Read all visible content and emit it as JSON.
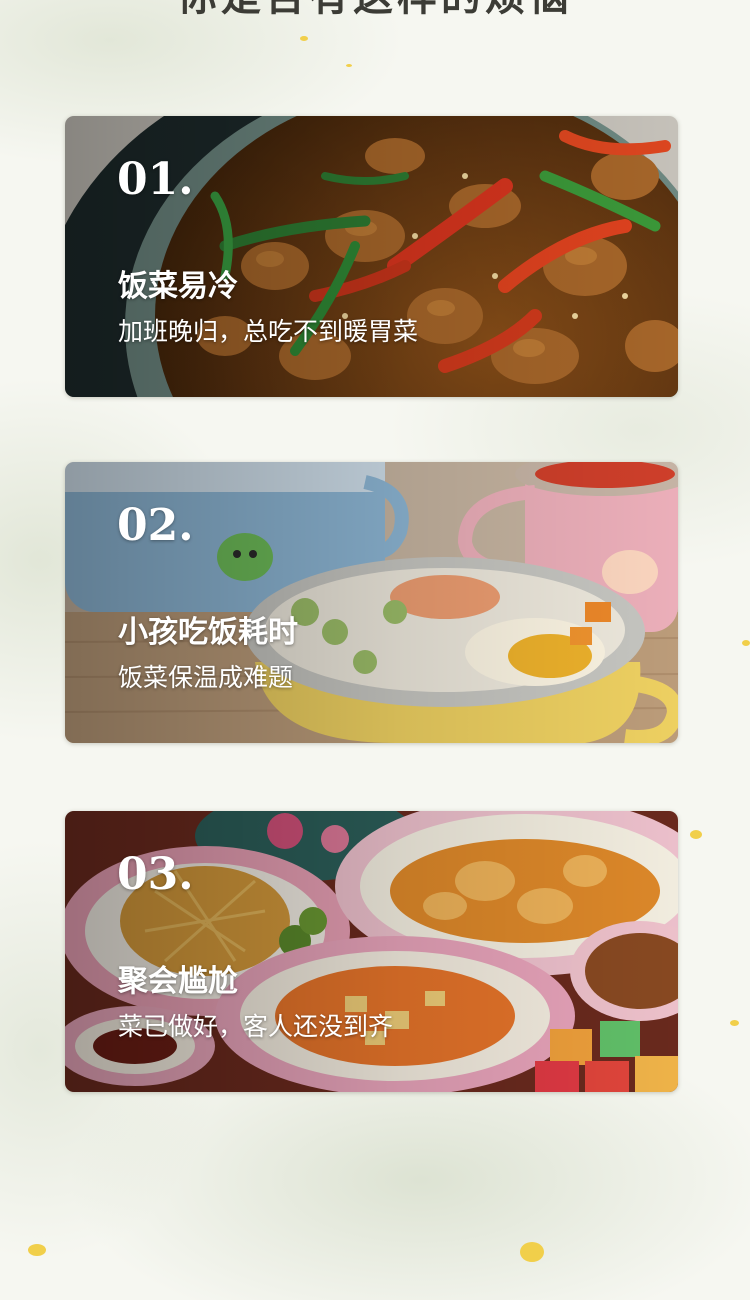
{
  "page": {
    "heading": "你是否有这样的烦恼"
  },
  "cards": [
    {
      "number": "01.",
      "title": "饭菜易冷",
      "subtitle": "加班晚归，总吃不到暖胃菜"
    },
    {
      "number": "02.",
      "title": "小孩吃饭耗时",
      "subtitle": "饭菜保温成难题"
    },
    {
      "number": "03.",
      "title": "聚会尴尬",
      "subtitle": "菜已做好，客人还没到齐"
    }
  ],
  "colors": {
    "background": "#f6f7f1",
    "accent_gold": "#f1cf4a",
    "card_text": "#ffffff"
  }
}
